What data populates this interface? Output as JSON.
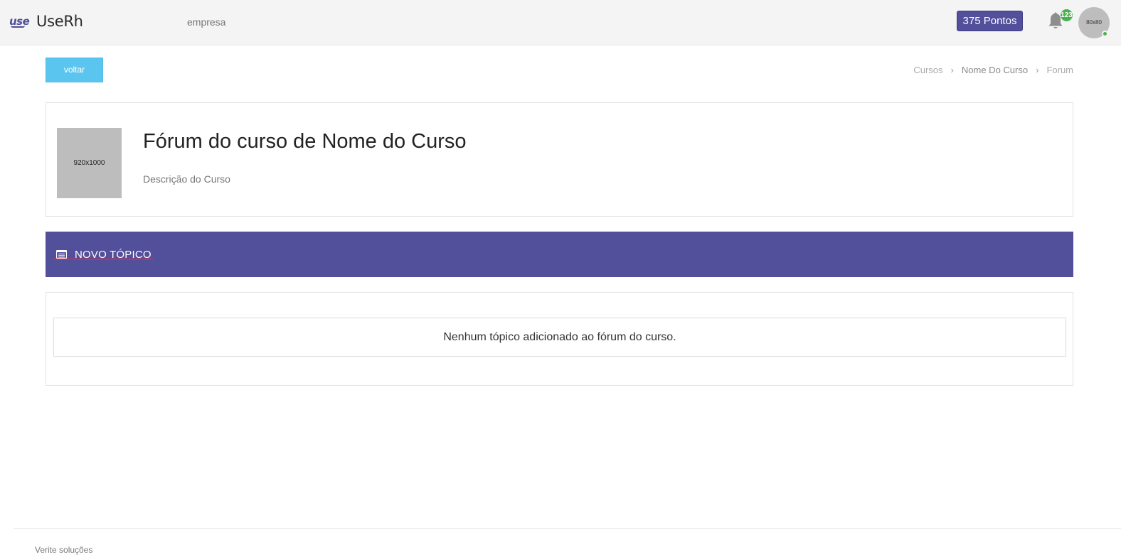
{
  "header": {
    "logo_mark": "use",
    "app_name": "UseRh",
    "company": "empresa",
    "points": "375 Pontos",
    "notifications_count": "123",
    "avatar_placeholder": "80x80",
    "bell_icon": "bell-icon",
    "colors": {
      "brand": "#524f9b",
      "online": "#4caf50",
      "bar_bg": "#f4f4f4"
    }
  },
  "actions": {
    "back_label": "voltar",
    "back_color": "#5ac6ef"
  },
  "breadcrumb": {
    "items": [
      "Cursos",
      "Nome Do Curso",
      "Forum"
    ],
    "separator_icon": "chevron-right-icon"
  },
  "course": {
    "thumb_placeholder": "920x1000",
    "title": "Fórum do curso de Nome do Curso",
    "description": "Descrição do Curso"
  },
  "topic_bar": {
    "new_topic_label": "NOVO TÓPICO",
    "icon": "list-card-icon",
    "accent_underline": "#e0263e"
  },
  "topics": {
    "empty_message": "Nenhum tópico adicionado ao fórum do curso."
  },
  "footer": {
    "text": "Verite soluções"
  }
}
